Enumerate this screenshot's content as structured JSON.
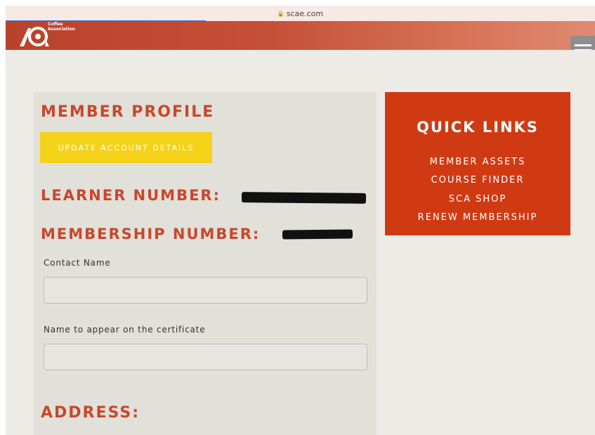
{
  "browser": {
    "url": "scae.com"
  },
  "header": {
    "logo_text": "Coffee\nAssociation"
  },
  "profile": {
    "title": "MEMBER PROFILE",
    "update_button": "UPDATE ACCOUNT DETAILS",
    "learner_label": "LEARNER NUMBER:",
    "membership_label": "MEMBERSHIP NUMBER:",
    "contact_label": "Contact Name",
    "contact_value": "",
    "certificate_label": "Name to appear on the certificate",
    "certificate_value": "",
    "address_heading": "ADDRESS:"
  },
  "quick_links": {
    "title": "QUICK LINKS",
    "items": [
      "MEMBER ASSETS",
      "COURSE FINDER",
      "SCA SHOP",
      "RENEW MEMBERSHIP"
    ]
  },
  "colors": {
    "accent": "#c8472c",
    "quick_bg": "#cf3a13",
    "button": "#f5d21a",
    "panel": "#e1e0d9"
  }
}
